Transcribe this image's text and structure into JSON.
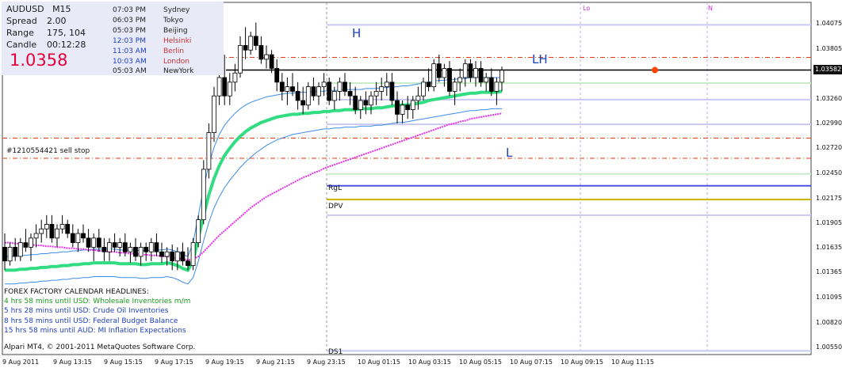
{
  "window": {
    "symbol": "AUDUSD",
    "timeframe": "M15"
  },
  "info": {
    "spread_label": "Spread",
    "spread_value": "2.00",
    "range_label": "Range",
    "range_value": "175, 104",
    "candle_label": "Candle",
    "candle_value": "00:12:28",
    "price": "1.0358",
    "price_color": "#e8003a",
    "panel_bg": "#e8eaf8"
  },
  "sessions": [
    {
      "time": "07:03 PM",
      "city": "Sydney",
      "color": "#222222"
    },
    {
      "time": "06:03 PM",
      "city": "Tokyo",
      "color": "#222222"
    },
    {
      "time": "05:03 PM",
      "city": "Beijing",
      "color": "#222222"
    },
    {
      "time": "12:03 PM",
      "city": "Helsinki",
      "color": "#c83232"
    },
    {
      "time": "11:03 AM",
      "city": "Berlin",
      "color": "#c83232"
    },
    {
      "time": "10:03 AM",
      "city": "London",
      "color": "#c83232"
    },
    {
      "time": "05:03 AM",
      "city": "NewYork",
      "color": "#222222"
    }
  ],
  "session_time_colors": [
    "#222222",
    "#222222",
    "#222222",
    "#1f3ebf",
    "#1f3ebf",
    "#1f3ebf",
    "#222222"
  ],
  "annotations": {
    "sell_stop": "#1210554421 sell stop",
    "high_label": "H",
    "lower_high_label": "LH",
    "low_label": "L",
    "rgl_label": "RgL",
    "dpv_label": "DPV",
    "ds1_label": "DS1",
    "lo_label": "Lo",
    "n_label": "N",
    "hl_color": "#1f3ebf",
    "marker_color": "#ff4400"
  },
  "calendar": {
    "title": "FOREX FACTORY CALENDAR HEADLINES:",
    "items": [
      {
        "text": "4 hrs 58 mins until USD: Wholesale Inventories m/m",
        "color": "#1a9a1a"
      },
      {
        "text": "5 hrs 28 mins until USD: Crude Oil Inventories",
        "color": "#1f3ebf"
      },
      {
        "text": "8 hrs 58 mins until USD: Federal Budget Balance",
        "color": "#1f3ebf"
      },
      {
        "text": "15 hrs 58 mins until AUD: MI Inflation Expectations",
        "color": "#1f3ebf"
      }
    ]
  },
  "copyright": "Alpari MT4, © 2001-2011 MetaQuotes Software Corp.",
  "price_axis": {
    "ticks": [
      "1.04075",
      "1.03805",
      "1.03582",
      "1.03260",
      "1.02990",
      "1.02720",
      "1.02450",
      "1.02175",
      "1.01905",
      "1.01635",
      "1.01365",
      "1.01095",
      "1.00820",
      "1.00550"
    ],
    "current": "1.03582"
  },
  "time_axis": {
    "ticks": [
      "9 Aug 2011",
      "9 Aug 13:15",
      "9 Aug 15:15",
      "9 Aug 17:15",
      "9 Aug 19:15",
      "9 Aug 21:15",
      "9 Aug 23:15",
      "10 Aug 01:15",
      "10 Aug 03:15",
      "10 Aug 05:15",
      "10 Aug 07:15",
      "10 Aug 09:15",
      "10 Aug 11:15"
    ]
  },
  "chart_data": {
    "type": "candlestick",
    "symbol": "AUDUSD",
    "timeframe": "M15",
    "ylim": [
      1.0048,
      1.0432
    ],
    "current_price": 1.03582,
    "levels": [
      {
        "price": 1.04075,
        "color": "#c8c8f0",
        "style": "solid"
      },
      {
        "price": 1.0372,
        "color": "#e03c14",
        "style": "dashdot"
      },
      {
        "price": 1.03582,
        "color": "#000000",
        "style": "solid"
      },
      {
        "price": 1.0344,
        "color": "#c8ecc8",
        "style": "solid"
      },
      {
        "price": 1.0326,
        "color": "#c8c8f0",
        "style": "solid"
      },
      {
        "price": 1.0299,
        "color": "#c8c8f0",
        "style": "solid"
      },
      {
        "price": 1.0284,
        "color": "#e03c14",
        "style": "dashdot"
      },
      {
        "price": 1.0262,
        "color": "#e03c14",
        "style": "dashdot"
      },
      {
        "price": 1.0245,
        "color": "#c8ecc8",
        "style": "solid"
      },
      {
        "price": 1.0232,
        "color": "#5050e6",
        "style": "solid"
      },
      {
        "price": 1.0217,
        "color": "#c8b400",
        "style": "solid"
      },
      {
        "price": 1.02,
        "color": "#c8c8f0",
        "style": "solid"
      },
      {
        "price": 1.0052,
        "color": "#c8c8f0",
        "style": "solid"
      }
    ],
    "candles": [
      [
        1.0165,
        1.018,
        1.014,
        1.015
      ],
      [
        1.015,
        1.017,
        1.0145,
        1.0165
      ],
      [
        1.0165,
        1.0175,
        1.015,
        1.0155
      ],
      [
        1.0155,
        1.0175,
        1.015,
        1.017
      ],
      [
        1.017,
        1.0185,
        1.016,
        1.0165
      ],
      [
        1.0165,
        1.018,
        1.015,
        1.0175
      ],
      [
        1.0175,
        1.019,
        1.0165,
        1.018
      ],
      [
        1.018,
        1.0195,
        1.017,
        1.0185
      ],
      [
        1.0185,
        1.02,
        1.0175,
        1.019
      ],
      [
        1.019,
        1.02,
        1.017,
        1.0175
      ],
      [
        1.0175,
        1.019,
        1.0165,
        1.0185
      ],
      [
        1.0185,
        1.02,
        1.018,
        1.019
      ],
      [
        1.019,
        1.0195,
        1.0175,
        1.018
      ],
      [
        1.018,
        1.019,
        1.0165,
        1.017
      ],
      [
        1.017,
        1.0185,
        1.016,
        1.018
      ],
      [
        1.018,
        1.019,
        1.017,
        1.0175
      ],
      [
        1.0175,
        1.0185,
        1.016,
        1.0165
      ],
      [
        1.0165,
        1.018,
        1.015,
        1.0175
      ],
      [
        1.0175,
        1.0185,
        1.016,
        1.0165
      ],
      [
        1.0165,
        1.0175,
        1.015,
        1.016
      ],
      [
        1.016,
        1.0175,
        1.015,
        1.017
      ],
      [
        1.017,
        1.018,
        1.016,
        1.0165
      ],
      [
        1.0165,
        1.0175,
        1.0155,
        1.017
      ],
      [
        1.017,
        1.018,
        1.0155,
        1.016
      ],
      [
        1.016,
        1.017,
        1.0148,
        1.0165
      ],
      [
        1.0165,
        1.0175,
        1.015,
        1.0155
      ],
      [
        1.0155,
        1.017,
        1.0145,
        1.0165
      ],
      [
        1.0165,
        1.017,
        1.015,
        1.016
      ],
      [
        1.016,
        1.0175,
        1.015,
        1.017
      ],
      [
        1.017,
        1.018,
        1.0155,
        1.016
      ],
      [
        1.016,
        1.017,
        1.0148,
        1.0155
      ],
      [
        1.0155,
        1.0165,
        1.0145,
        1.016
      ],
      [
        1.016,
        1.0168,
        1.014,
        1.015
      ],
      [
        1.015,
        1.0165,
        1.014,
        1.016
      ],
      [
        1.016,
        1.017,
        1.0145,
        1.015
      ],
      [
        1.015,
        1.0165,
        1.014,
        1.0145
      ],
      [
        1.0145,
        1.0175,
        1.014,
        1.017
      ],
      [
        1.017,
        1.02,
        1.0165,
        1.0195
      ],
      [
        1.0195,
        1.026,
        1.019,
        1.025
      ],
      [
        1.025,
        1.03,
        1.024,
        1.029
      ],
      [
        1.029,
        1.034,
        1.028,
        1.033
      ],
      [
        1.033,
        1.037,
        1.032,
        1.035
      ],
      [
        1.035,
        1.0375,
        1.032,
        1.033
      ],
      [
        1.033,
        1.0355,
        1.032,
        1.0345
      ],
      [
        1.0345,
        1.0365,
        1.0335,
        1.0355
      ],
      [
        1.0355,
        1.0395,
        1.035,
        1.0385
      ],
      [
        1.0385,
        1.0405,
        1.037,
        1.038
      ],
      [
        1.038,
        1.04,
        1.0375,
        1.0395
      ],
      [
        1.0395,
        1.041,
        1.038,
        1.0385
      ],
      [
        1.0385,
        1.0395,
        1.0365,
        1.037
      ],
      [
        1.037,
        1.0385,
        1.036,
        1.0375
      ],
      [
        1.0375,
        1.038,
        1.0355,
        1.036
      ],
      [
        1.036,
        1.037,
        1.0335,
        1.0345
      ],
      [
        1.0345,
        1.0355,
        1.0325,
        1.0335
      ],
      [
        1.0335,
        1.035,
        1.032,
        1.034
      ],
      [
        1.034,
        1.0355,
        1.033,
        1.0335
      ],
      [
        1.0335,
        1.0345,
        1.0315,
        1.0325
      ],
      [
        1.0325,
        1.034,
        1.031,
        1.032
      ],
      [
        1.032,
        1.0345,
        1.0315,
        1.034
      ],
      [
        1.034,
        1.035,
        1.0325,
        1.033
      ],
      [
        1.033,
        1.0345,
        1.032,
        1.034
      ],
      [
        1.034,
        1.0355,
        1.033,
        1.0345
      ],
      [
        1.0345,
        1.035,
        1.032,
        1.0325
      ],
      [
        1.0325,
        1.034,
        1.0315,
        1.0335
      ],
      [
        1.0335,
        1.035,
        1.0325,
        1.0345
      ],
      [
        1.0345,
        1.0355,
        1.033,
        1.0335
      ],
      [
        1.0335,
        1.0345,
        1.032,
        1.033
      ],
      [
        1.033,
        1.034,
        1.031,
        1.0315
      ],
      [
        1.0315,
        1.033,
        1.0305,
        1.0325
      ],
      [
        1.0325,
        1.0335,
        1.031,
        1.032
      ],
      [
        1.032,
        1.0335,
        1.031,
        1.033
      ],
      [
        1.033,
        1.0345,
        1.032,
        1.0335
      ],
      [
        1.0335,
        1.035,
        1.0325,
        1.034
      ],
      [
        1.034,
        1.0355,
        1.033,
        1.0345
      ],
      [
        1.0345,
        1.0355,
        1.032,
        1.0325
      ],
      [
        1.0325,
        1.0335,
        1.03,
        1.031
      ],
      [
        1.031,
        1.0325,
        1.03,
        1.032
      ],
      [
        1.032,
        1.033,
        1.0305,
        1.0315
      ],
      [
        1.0315,
        1.033,
        1.0305,
        1.0325
      ],
      [
        1.0325,
        1.034,
        1.0315,
        1.033
      ],
      [
        1.033,
        1.035,
        1.0325,
        1.0345
      ],
      [
        1.0345,
        1.036,
        1.0335,
        1.034
      ],
      [
        1.034,
        1.037,
        1.0335,
        1.0365
      ],
      [
        1.0365,
        1.0375,
        1.0345,
        1.035
      ],
      [
        1.035,
        1.0365,
        1.034,
        1.036
      ],
      [
        1.036,
        1.0368,
        1.033,
        1.0335
      ],
      [
        1.0335,
        1.035,
        1.032,
        1.0345
      ],
      [
        1.0345,
        1.036,
        1.0335,
        1.035
      ],
      [
        1.035,
        1.037,
        1.034,
        1.0365
      ],
      [
        1.0365,
        1.037,
        1.0345,
        1.035
      ],
      [
        1.035,
        1.0368,
        1.034,
        1.036
      ],
      [
        1.036,
        1.0368,
        1.034,
        1.0345
      ],
      [
        1.0345,
        1.0355,
        1.0335,
        1.035
      ],
      [
        1.035,
        1.036,
        1.033,
        1.0335
      ],
      [
        1.0335,
        1.035,
        1.032,
        1.0345
      ],
      [
        1.0345,
        1.0362,
        1.0335,
        1.0358
      ]
    ],
    "series": [
      {
        "name": "",
        "type": "ma_green",
        "color": "#32dc82",
        "values": [
          1.014,
          1.014,
          1.014,
          1.0141,
          1.0141,
          1.0142,
          1.0142,
          1.0143,
          1.0143,
          1.0144,
          1.0144,
          1.0145,
          1.0145,
          1.0146,
          1.0146,
          1.0147,
          1.0147,
          1.0148,
          1.0148,
          1.0148,
          1.0148,
          1.0148,
          1.0147,
          1.0147,
          1.0147,
          1.0147,
          1.0146,
          1.0146,
          1.0147,
          1.0147,
          1.0147,
          1.0148,
          1.0147,
          1.0145,
          1.0142,
          1.014,
          1.015,
          1.0175,
          1.02,
          1.0222,
          1.024,
          1.0254,
          1.0265,
          1.0273,
          1.028,
          1.0286,
          1.0291,
          1.0295,
          1.0298,
          1.0301,
          1.0303,
          1.0305,
          1.0307,
          1.0308,
          1.0309,
          1.031,
          1.031,
          1.0311,
          1.0311,
          1.0312,
          1.0312,
          1.0313,
          1.0313,
          1.0314,
          1.0314,
          1.0315,
          1.0315,
          1.0315,
          1.0316,
          1.0316,
          1.0316,
          1.0317,
          1.0317,
          1.0318,
          1.0319,
          1.032,
          1.032,
          1.032,
          1.0321,
          1.0322,
          1.0323,
          1.0325,
          1.0326,
          1.0327,
          1.0328,
          1.0329,
          1.033,
          1.0331,
          1.0332,
          1.0333,
          1.0333,
          1.0334,
          1.0334,
          1.0334,
          1.0334,
          1.0335
        ]
      },
      {
        "name": "",
        "type": "band_upper",
        "color": "#3c8ce6",
        "values": [
          1.0155,
          1.0155,
          1.0155,
          1.0156,
          1.0156,
          1.0157,
          1.0157,
          1.0158,
          1.0158,
          1.0159,
          1.0159,
          1.016,
          1.016,
          1.0161,
          1.0161,
          1.0162,
          1.0162,
          1.0163,
          1.0163,
          1.0163,
          1.0163,
          1.0163,
          1.0162,
          1.0162,
          1.0162,
          1.0162,
          1.0161,
          1.0161,
          1.0162,
          1.0162,
          1.0162,
          1.0163,
          1.0162,
          1.016,
          1.0157,
          1.0155,
          1.017,
          1.02,
          1.023,
          1.0255,
          1.0274,
          1.0288,
          1.0298,
          1.0305,
          1.0311,
          1.0316,
          1.032,
          1.0323,
          1.0325,
          1.0327,
          1.0329,
          1.033,
          1.0331,
          1.0332,
          1.0333,
          1.0333,
          1.0334,
          1.0334,
          1.0334,
          1.0335,
          1.0335,
          1.0335,
          1.0336,
          1.0336,
          1.0336,
          1.0337,
          1.0337,
          1.0337,
          1.0337,
          1.0338,
          1.0338,
          1.0338,
          1.0339,
          1.0339,
          1.034,
          1.034,
          1.0341,
          1.0341,
          1.0342,
          1.0343,
          1.0344,
          1.0345,
          1.0346,
          1.0347,
          1.0347,
          1.0348,
          1.0348,
          1.0349,
          1.0349,
          1.035,
          1.035,
          1.035,
          1.035,
          1.035,
          1.035,
          1.035
        ]
      },
      {
        "name": "",
        "type": "band_lower",
        "color": "#3c8ce6",
        "values": [
          1.0125,
          1.0125,
          1.0125,
          1.0126,
          1.0126,
          1.0127,
          1.0127,
          1.0128,
          1.0128,
          1.0129,
          1.0129,
          1.013,
          1.013,
          1.0131,
          1.0131,
          1.0132,
          1.0132,
          1.0133,
          1.0133,
          1.0133,
          1.0133,
          1.0133,
          1.0132,
          1.0132,
          1.0132,
          1.0132,
          1.0131,
          1.0131,
          1.0132,
          1.0132,
          1.0132,
          1.0133,
          1.0132,
          1.013,
          1.0127,
          1.0125,
          1.0132,
          1.015,
          1.0172,
          1.0192,
          1.0208,
          1.022,
          1.023,
          1.0238,
          1.0245,
          1.0252,
          1.0258,
          1.0263,
          1.0268,
          1.0272,
          1.0276,
          1.0279,
          1.0282,
          1.0284,
          1.0286,
          1.0288,
          1.0289,
          1.029,
          1.0291,
          1.0292,
          1.0293,
          1.0294,
          1.0294,
          1.0295,
          1.0295,
          1.0296,
          1.0296,
          1.0296,
          1.0297,
          1.0297,
          1.0297,
          1.0298,
          1.0298,
          1.0299,
          1.03,
          1.0301,
          1.0301,
          1.0302,
          1.0303,
          1.0304,
          1.0305,
          1.0306,
          1.0307,
          1.0308,
          1.0309,
          1.031,
          1.0311,
          1.0312,
          1.0313,
          1.0314,
          1.0314,
          1.0315,
          1.0315,
          1.0316,
          1.0316,
          1.0316
        ]
      },
      {
        "name": "",
        "type": "ma_magenta",
        "color": "#e632e6",
        "values": [
          1.017,
          1.017,
          1.0169,
          1.0169,
          1.0168,
          1.0168,
          1.0167,
          1.0167,
          1.0166,
          1.0166,
          1.0165,
          1.0165,
          1.0164,
          1.0164,
          1.0163,
          1.0163,
          1.0162,
          1.0162,
          1.0161,
          1.0161,
          1.016,
          1.016,
          1.0159,
          1.0159,
          1.0158,
          1.0158,
          1.0157,
          1.0157,
          1.0156,
          1.0156,
          1.0155,
          1.0155,
          1.0154,
          1.0153,
          1.0152,
          1.0151,
          1.0152,
          1.0155,
          1.016,
          1.0166,
          1.0172,
          1.0178,
          1.0183,
          1.0188,
          1.0193,
          1.0198,
          1.0203,
          1.0208,
          1.0212,
          1.0216,
          1.022,
          1.0223,
          1.0226,
          1.0229,
          1.0232,
          1.0235,
          1.0238,
          1.0241,
          1.0243,
          1.0246,
          1.0248,
          1.0251,
          1.0253,
          1.0255,
          1.0257,
          1.0259,
          1.0261,
          1.0263,
          1.0265,
          1.0267,
          1.0269,
          1.0271,
          1.0273,
          1.0275,
          1.0277,
          1.0279,
          1.0281,
          1.0283,
          1.0285,
          1.0287,
          1.0289,
          1.0291,
          1.0293,
          1.0295,
          1.0297,
          1.0299,
          1.03,
          1.0302,
          1.0303,
          1.0305,
          1.0306,
          1.0307,
          1.0308,
          1.0309,
          1.031,
          1.0311
        ]
      }
    ]
  }
}
